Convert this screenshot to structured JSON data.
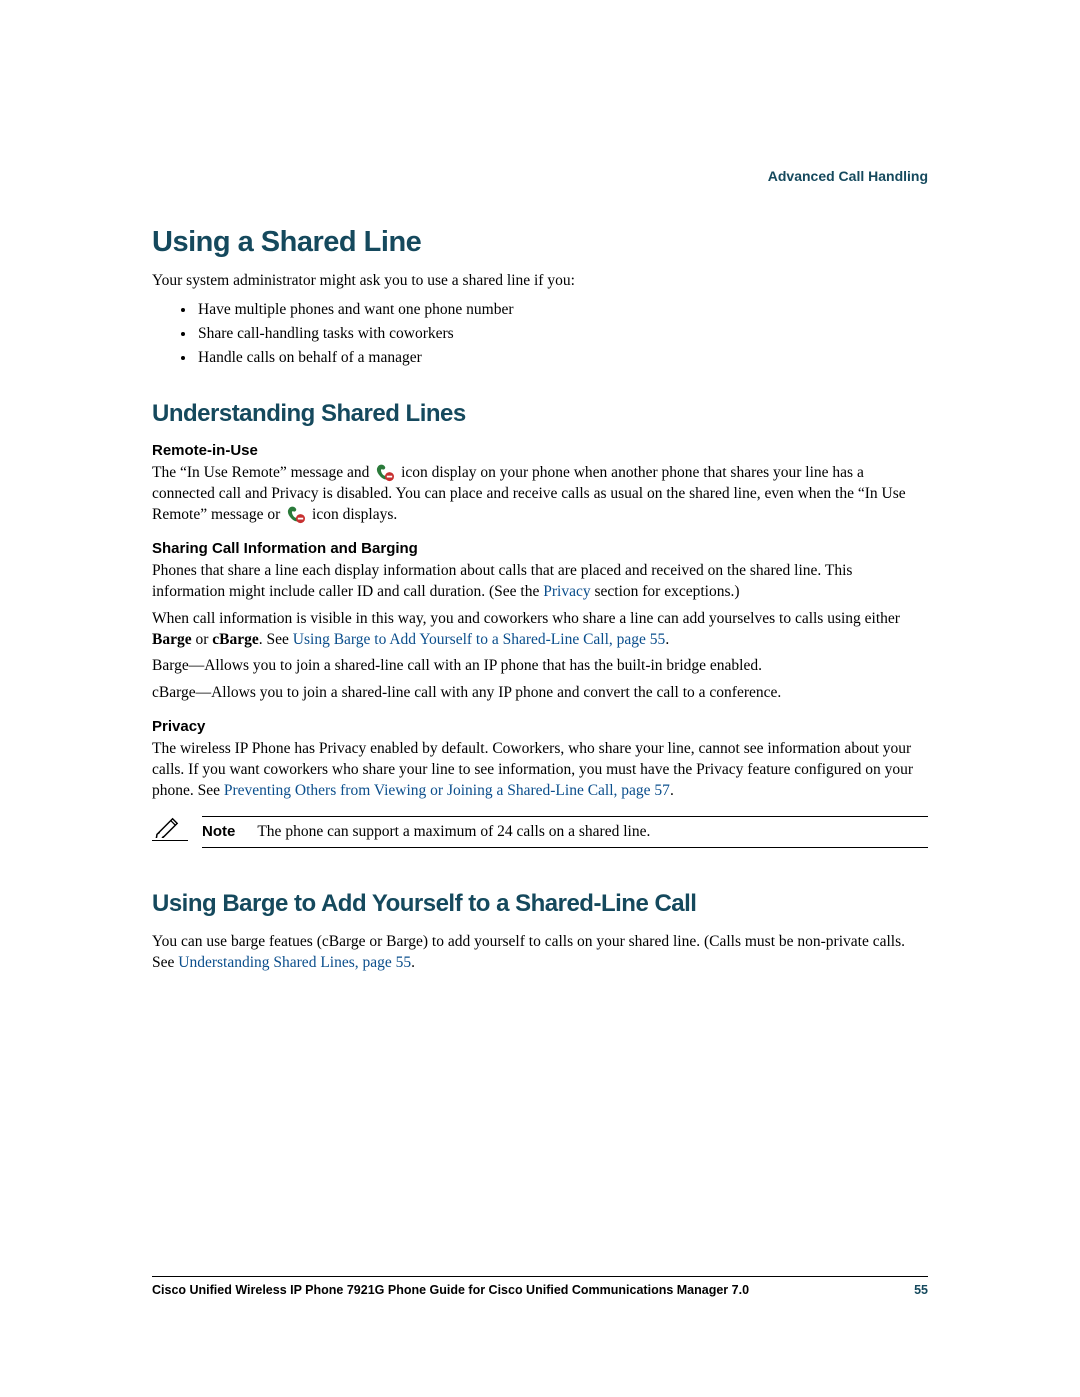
{
  "header": {
    "section": "Advanced Call Handling"
  },
  "h1": "Using a Shared Line",
  "intro": "Your system administrator might ask you to use a shared line if you:",
  "bullets": [
    "Have multiple phones and want one phone number",
    "Share call-handling tasks with coworkers",
    "Handle calls on behalf of a manager"
  ],
  "h2a": "Understanding Shared Lines",
  "remote": {
    "heading": "Remote-in-Use",
    "p_a": "The “In Use Remote” message and ",
    "p_b": " icon display on your phone when another phone that shares your line has a connected call and Privacy is disabled. You can place and receive calls as usual on the shared line, even when the “In Use Remote” message or ",
    "p_c": " icon displays."
  },
  "sharing": {
    "heading": "Sharing Call Information and Barging",
    "p1_a": "Phones that share a line each display information about calls that are placed and received on the shared line. This information might include caller ID and call duration. (See the ",
    "p1_link": "Privacy",
    "p1_b": " section for exceptions.)",
    "p2_a": "When call information is visible in this way, you and coworkers who share a line can add yourselves to calls using either ",
    "p2_bold1": "Barge",
    "p2_or": " or ",
    "p2_bold2": "cBarge",
    "p2_b": ". See ",
    "p2_link": "Using Barge to Add Yourself to a Shared-Line Call, page 55",
    "p2_c": ".",
    "p3": "Barge—Allows you to join a shared-line call with an IP phone that has the built-in bridge enabled.",
    "p4": "cBarge—Allows you to join a shared-line call with any IP phone and convert the call to a conference."
  },
  "privacy": {
    "heading": "Privacy",
    "p_a": "The wireless IP Phone has Privacy enabled by default. Coworkers, who share your line, cannot see information about your calls. If you want coworkers who share your line to see information, you must have the Privacy feature configured on your phone. See ",
    "p_link": "Preventing Others from Viewing or Joining a Shared-Line Call, page 57",
    "p_b": "."
  },
  "note": {
    "label": "Note",
    "text": "The phone can support a maximum of 24 calls on a shared line."
  },
  "h2b": "Using Barge to Add Yourself to a Shared-Line Call",
  "barge": {
    "p_a": "You can use barge featues (cBarge or Barge) to add yourself to calls on your shared line. (Calls must be non-private calls. See ",
    "p_link": "Understanding Shared Lines, page 55",
    "p_b": "."
  },
  "footer": {
    "title": "Cisco Unified Wireless IP Phone 7921G Phone Guide for Cisco Unified Communications Manager 7.0",
    "page": "55"
  }
}
